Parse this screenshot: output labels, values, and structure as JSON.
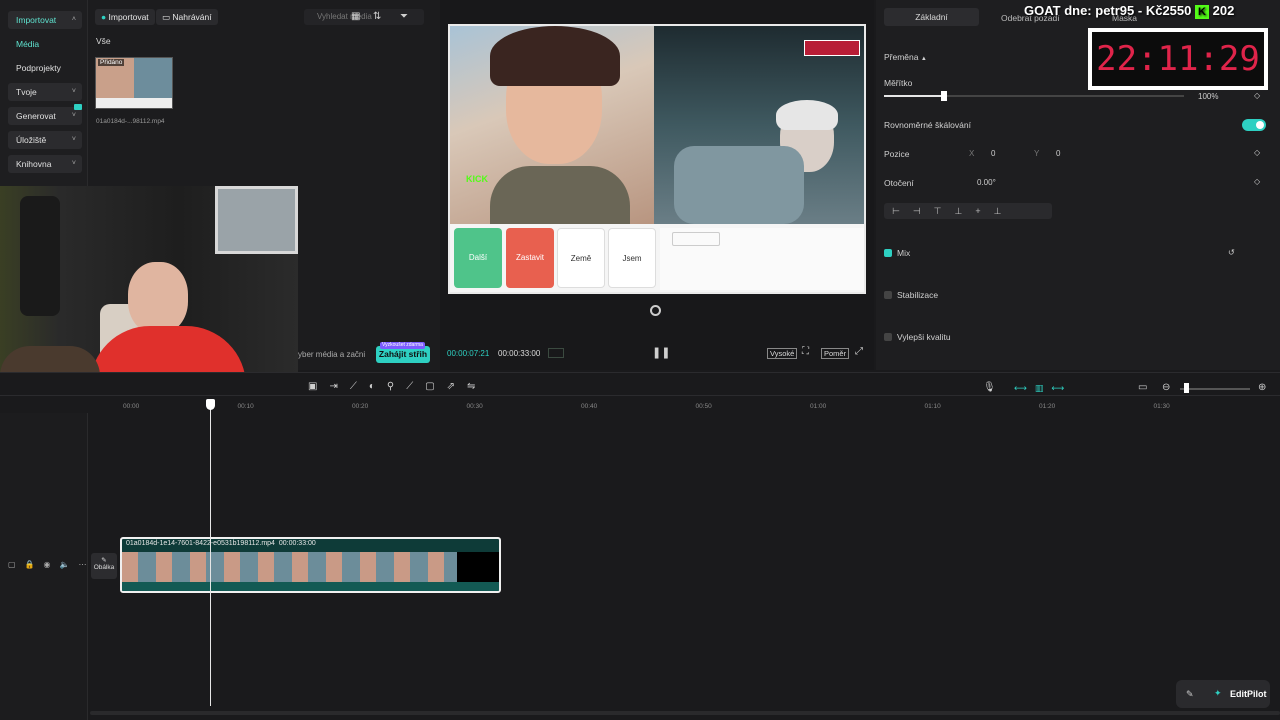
{
  "nav": {
    "items": [
      {
        "label": "Importovat",
        "chevron": "˄"
      },
      {
        "label": "Média"
      },
      {
        "label": "Podprojekty"
      },
      {
        "label": "Tvoje",
        "chevron": "˅"
      },
      {
        "label": "Generovat",
        "chevron": "˅"
      },
      {
        "label": "Úložiště",
        "chevron": "˅"
      },
      {
        "label": "Knihovna",
        "chevron": "˅"
      }
    ]
  },
  "media": {
    "import_label": "Importovat",
    "record_label": "Nahrávání",
    "search_placeholder": "Vyhledat média",
    "filter_all": "Vše",
    "thumb_badge": "Přidáno",
    "thumb_name": "01a0184d-...98112.mp4",
    "hint_text": "yber média a začni",
    "start_edit_label": "Zahájit střih",
    "start_edit_badge": "Vyzkoušet zdarma"
  },
  "player": {
    "current_time": "00:00:07:21",
    "total_time": "00:00:33:00",
    "quality_label": "Vysoké",
    "ratio_label": "Poměr",
    "kick_label": "KICK",
    "buttons": [
      "Další",
      "Zastavit",
      "Země",
      "Jsem"
    ]
  },
  "props": {
    "tabs": [
      "Základní",
      "Odebrat pozadí",
      "Maska"
    ],
    "transform_label": "Přeměna",
    "scale_label": "Měřítko",
    "scale_value": "100%",
    "uniform_label": "Rovnoměrné škálování",
    "position_label": "Pozice",
    "pos_x_label": "X",
    "pos_x": "0",
    "pos_y_label": "Y",
    "pos_y": "0",
    "rotation_label": "Otočení",
    "rotation_value": "0.00°",
    "mix_label": "Mix",
    "stab_label": "Stabilizace",
    "quality_label": "Vylepši kvalitu"
  },
  "overlay": {
    "goat_text": "GOAT dne: petr95 - Kč2550",
    "goat_count": "202",
    "clock": "22:11:29"
  },
  "timeline": {
    "ruler": [
      "00:00",
      "00:10",
      "00:20",
      "00:30",
      "00:40",
      "00:50",
      "01:00",
      "01:10",
      "01:20",
      "01:30"
    ],
    "clip_name": "01a0184d-1e14-7601-8422-e0531b198112.mp4",
    "clip_duration": "00:00:33:00",
    "cover_label": "Obálka"
  },
  "editpilot": {
    "label": "EditPilot"
  },
  "colors": {
    "accent": "#2ed0c2",
    "clock_red": "#e0244a",
    "kick_green": "#53fc18",
    "red_button": "#e8604f"
  }
}
